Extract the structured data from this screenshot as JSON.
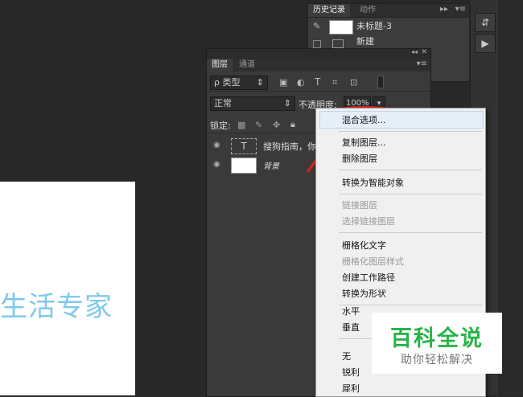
{
  "canvas": {
    "text": "生活专家"
  },
  "history_panel": {
    "tabs": [
      "历史记录",
      "动作"
    ],
    "rows": [
      "未标题-3",
      "新建"
    ]
  },
  "layers_panel": {
    "tabs": [
      "图层",
      "通道"
    ],
    "filter_label": "ρ 类型",
    "blend_mode": "正常",
    "opacity_label": "不透明度:",
    "opacity_value": "100%",
    "lock_label": "锁定:",
    "layers": [
      {
        "type_icon": "T",
        "name": "搜狗指南，你"
      },
      {
        "type_icon": "",
        "name": "背景"
      }
    ]
  },
  "context_menu": {
    "groups": [
      [
        {
          "label": "混合选项...",
          "enabled": true,
          "highlighted": true
        }
      ],
      [
        {
          "label": "复制图层...",
          "enabled": true
        },
        {
          "label": "删除图层",
          "enabled": true
        }
      ],
      [
        {
          "label": "转换为智能对象",
          "enabled": true
        }
      ],
      [
        {
          "label": "链接图层",
          "enabled": false
        },
        {
          "label": "选择链接图层",
          "enabled": false
        }
      ],
      [
        {
          "label": "栅格化文字",
          "enabled": true
        },
        {
          "label": "栅格化图层样式",
          "enabled": false
        },
        {
          "label": "创建工作路径",
          "enabled": true
        },
        {
          "label": "转换为形状",
          "enabled": true
        }
      ],
      [
        {
          "label": "水平",
          "enabled": true
        },
        {
          "label": "垂直",
          "enabled": true
        }
      ],
      [
        {
          "label": "无",
          "enabled": true
        },
        {
          "label": "锐利",
          "enabled": true
        },
        {
          "label": "犀利",
          "enabled": true
        }
      ]
    ]
  },
  "watermark": {
    "title": "百科全说",
    "subtitle": "助你轻松解决"
  },
  "colors": {
    "annotation_red": "#e02020",
    "watermark_green": "#28b44a",
    "canvas_text": "#7ec8ee"
  }
}
